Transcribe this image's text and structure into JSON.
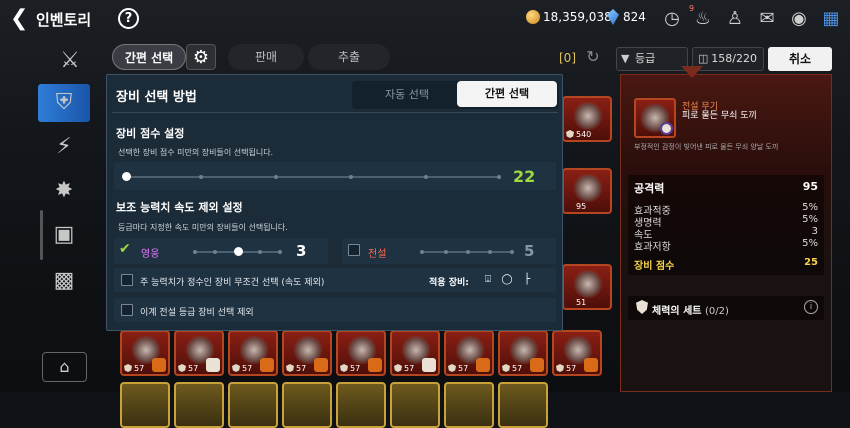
{
  "header": {
    "title": "인벤토리",
    "help": "?",
    "gold": "18,359,038",
    "gems": "824",
    "mail_badge": "9"
  },
  "toolbar": {
    "tab_easy": "간편 선택",
    "tab_sell": "판매",
    "tab_extract": "추출",
    "count": "[0]",
    "grade_filter": "등급",
    "capacity": "158/220",
    "cancel": "취소"
  },
  "grid": {
    "levels": [
      "540",
      "95",
      "51",
      "57",
      "57",
      "57",
      "57",
      "57",
      "57",
      "57",
      "57",
      "57"
    ]
  },
  "modal": {
    "title": "장비 선택 방법",
    "seg_auto": "자동 선택",
    "seg_easy": "간편 선택",
    "score_title": "장비 점수 설정",
    "score_desc": "선택한 장비 점수 미만의 장비들이 선택됩니다.",
    "score_value": "22",
    "speed_title": "보조 능력치 속도 제외 설정",
    "speed_desc": "등급마다 지정한 속도 미만의 장비들이 선택됩니다.",
    "hero_label": "영웅",
    "hero_value": "3",
    "hero_checked": true,
    "legend_label": "전설",
    "legend_value": "5",
    "legend_checked": false,
    "integer_row": "주 능력치가 정수인 장비 무조건 선택 (속도 제외)",
    "apply_label": "적용 장비:",
    "exclude_legend_row": "이계 전설 등급 장비 선택 제외"
  },
  "detail": {
    "type": "전설 무기",
    "name": "피로 물든 무쇠 도끼",
    "desc": "부정적인 감정이 빚어낸 피로 물든 무쇠 양날 도끼",
    "stats": [
      {
        "label": "공격력",
        "value": "95"
      },
      {
        "label": "효과적중",
        "value": "5%"
      },
      {
        "label": "생명력",
        "value": "5%"
      },
      {
        "label": "속도",
        "value": "3"
      },
      {
        "label": "효과저항",
        "value": "5%"
      },
      {
        "label": "장비 점수",
        "value": "25"
      }
    ],
    "set_label": "체력의 세트",
    "set_count": "(0/2)"
  },
  "colors": {
    "accent_green": "#9ed93f",
    "hero_purple": "#e27aff",
    "legend_red": "#ff6a4a",
    "score_gold": "#f6d24a",
    "modal_bg": "#1b2b38"
  },
  "icons": [
    "back-arrow-icon",
    "help-icon",
    "gold-coin-icon",
    "gem-icon",
    "clock-icon",
    "bell-icon",
    "group-icon",
    "mail-icon",
    "chat-icon",
    "grid-menu-icon",
    "sword-equip-icon",
    "shield-icon",
    "lightning-icon",
    "gear-art-icon",
    "box-icon",
    "chest-icon",
    "home-icon",
    "gear-settings-icon",
    "refresh-icon",
    "filter-icon",
    "bag-icon",
    "ring-icon",
    "necklace-icon",
    "boots-icon"
  ]
}
